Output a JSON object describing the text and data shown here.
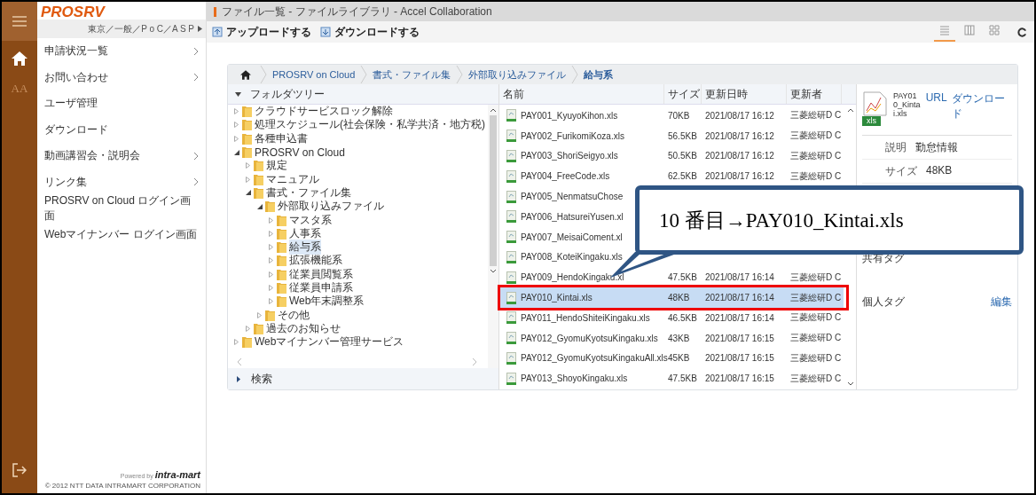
{
  "rail": {
    "font_size_glyph": "AA"
  },
  "brand": {
    "logo": "PROSRV",
    "org_path": "東京／一般／P o C／A S P"
  },
  "sidebar": {
    "items": [
      {
        "label": "申請状況一覧",
        "chevron": true
      },
      {
        "label": "お問い合わせ",
        "chevron": true
      },
      {
        "label": "ユーザ管理",
        "chevron": false
      },
      {
        "label": "ダウンロード",
        "chevron": false
      },
      {
        "label": "動画講習会・説明会",
        "chevron": true
      },
      {
        "label": "リンク集",
        "chevron": true
      },
      {
        "label": "PROSRV on Cloud ログイン画面",
        "chevron": false
      },
      {
        "label": "Webマイナンバー ログイン画面",
        "chevron": false
      }
    ],
    "powered_by": "Powered by",
    "vendor_logo": "intra-mart",
    "copyright": "© 2012 NTT DATA INTRAMART CORPORATION"
  },
  "window": {
    "title": "ファイル一覧 - ファイルライブラリ - Accel Collaboration"
  },
  "toolbar": {
    "buttons": [
      "アップロードする",
      "ダウンロードする"
    ],
    "view_modes": [
      {
        "kind": "list",
        "selected": true
      },
      {
        "kind": "columns",
        "selected": false
      },
      {
        "kind": "grid",
        "selected": false
      }
    ]
  },
  "breadcrumb": [
    "PROSRV on Cloud",
    "書式・ファイル集",
    "外部取り込みファイル",
    "給与系"
  ],
  "tree": {
    "title": "フォルダツリー",
    "search_label": "検索",
    "items": [
      {
        "label": "クラウドサービスロック解除",
        "expanded": false,
        "selected": false
      },
      {
        "label": "処理スケジュール(社会保険・私学共済・地方税)",
        "expanded": false,
        "selected": false
      },
      {
        "label": "各種申込書",
        "expanded": false,
        "selected": false
      },
      {
        "label": "PROSRV on Cloud",
        "expanded": true,
        "selected": false,
        "children": [
          {
            "label": "規定",
            "expanded": false,
            "selected": false
          },
          {
            "label": "マニュアル",
            "expanded": false,
            "selected": false
          },
          {
            "label": "書式・ファイル集",
            "expanded": true,
            "selected": false,
            "children": [
              {
                "label": "外部取り込みファイル",
                "expanded": true,
                "selected": false,
                "children": [
                  {
                    "label": "マスタ系",
                    "expanded": false,
                    "selected": false
                  },
                  {
                    "label": "人事系",
                    "expanded": false,
                    "selected": false
                  },
                  {
                    "label": "給与系",
                    "expanded": false,
                    "selected": true
                  },
                  {
                    "label": "拡張機能系",
                    "expanded": false,
                    "selected": false
                  },
                  {
                    "label": "従業員閲覧系",
                    "expanded": false,
                    "selected": false
                  },
                  {
                    "label": "従業員申請系",
                    "expanded": false,
                    "selected": false
                  },
                  {
                    "label": "Web年末調整系",
                    "expanded": false,
                    "selected": false
                  }
                ]
              },
              {
                "label": "その他",
                "expanded": false,
                "selected": false
              }
            ]
          },
          {
            "label": "過去のお知らせ",
            "expanded": false,
            "selected": false
          }
        ]
      },
      {
        "label": "Webマイナンバー管理サービス",
        "expanded": false,
        "selected": false
      }
    ]
  },
  "table": {
    "columns": [
      "名前",
      "サイズ",
      "更新日時",
      "更新者"
    ],
    "rows": [
      {
        "name": "PAY001_KyuyoKihon.xls",
        "size": "70KB",
        "updated": "2021/08/17 16:12",
        "updater": "三菱総研D C",
        "selected": false,
        "highlighted": false
      },
      {
        "name": "PAY002_FurikomiKoza.xls",
        "size": "56.5KB",
        "updated": "2021/08/17 16:12",
        "updater": "三菱総研D C",
        "selected": false,
        "highlighted": false
      },
      {
        "name": "PAY003_ShoriSeigyo.xls",
        "size": "50.5KB",
        "updated": "2021/08/17 16:12",
        "updater": "三菱総研D C",
        "selected": false,
        "highlighted": false
      },
      {
        "name": "PAY004_FreeCode.xls",
        "size": "62.5KB",
        "updated": "2021/08/17 16:12",
        "updater": "三菱総研D C",
        "selected": false,
        "highlighted": false
      },
      {
        "name": "PAY005_NenmatsuChose",
        "selected": false,
        "highlighted": false
      },
      {
        "name": "PAY006_HatsureiYusen.xl",
        "selected": false,
        "highlighted": false
      },
      {
        "name": "PAY007_MeisaiComent.xl",
        "selected": false,
        "highlighted": false
      },
      {
        "name": "PAY008_KoteiKingaku.xls",
        "selected": false,
        "highlighted": false
      },
      {
        "name": "PAY009_HendoKingaku.xl",
        "size": "47.5KB",
        "updated": "2021/08/17 16:14",
        "updater": "三菱総研D C",
        "selected": false,
        "highlighted": false
      },
      {
        "name": "PAY010_Kintai.xls",
        "size": "48KB",
        "updated": "2021/08/17 16:14",
        "updater": "三菱総研D C",
        "selected": true,
        "highlighted": true
      },
      {
        "name": "PAY011_HendoShiteiKingaku.xls",
        "size": "46.5KB",
        "updated": "2021/08/17 16:14",
        "updater": "三菱総研D C",
        "selected": false,
        "highlighted": false
      },
      {
        "name": "PAY012_GyomuKyotsuKingaku.xls",
        "size": "43KB",
        "updated": "2021/08/17 16:15",
        "updater": "三菱総研D C",
        "selected": false,
        "highlighted": false
      },
      {
        "name": "PAY012_GyomuKyotsuKingakuAll.xls",
        "size": "45KB",
        "updated": "2021/08/17 16:15",
        "updater": "三菱総研D C",
        "selected": false,
        "highlighted": false
      },
      {
        "name": "PAY013_ShoyoKingaku.xls",
        "size": "47.5KB",
        "updated": "2021/08/17 16:15",
        "updater": "三菱総研D C",
        "selected": false,
        "highlighted": false
      }
    ]
  },
  "details": {
    "file_name": "PAY010_Kintai.xls",
    "file_badge": "xls",
    "links": [
      "URL",
      "ダウンロード"
    ],
    "fields": [
      {
        "label": "説明",
        "value": "勤怠情報"
      },
      {
        "label": "サイズ",
        "value": "48KB"
      }
    ],
    "shared_tags_label": "共有タグ",
    "personal_tags_label": "個人タグ",
    "edit_link": "編集"
  },
  "callout": {
    "text": "10 番目→PAY010_Kintai.xls"
  }
}
